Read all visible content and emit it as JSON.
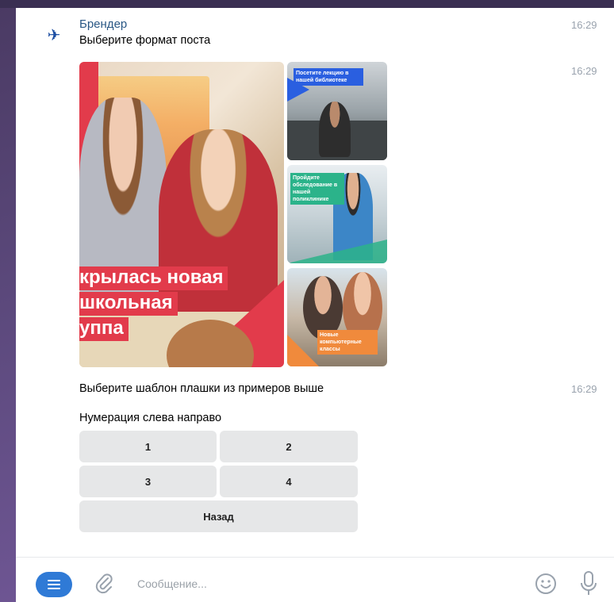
{
  "sender": {
    "name": "Брендер",
    "avatar_icon": "brender-logo-icon"
  },
  "messages": {
    "m1": {
      "text": "Выберите формат поста",
      "time": "16:29"
    },
    "m2": {
      "time": "16:29"
    },
    "m3": {
      "text": "Выберите шаблон плашки из примеров выше",
      "time": "16:29"
    },
    "m4": {
      "text": "Нумерация слева направо"
    }
  },
  "gallery": {
    "big_caption": [
      "крылась новая",
      "школьная",
      "уппа"
    ],
    "tile1_label": "Посетите лекцию в нашей библиотеке",
    "tile2_label": "Пройдите обследование в нашей поликлинике",
    "tile3_label": "Новые компьютерные классы"
  },
  "keyboard": {
    "btn1": "1",
    "btn2": "2",
    "btn3": "3",
    "btn4": "4",
    "back": "Назад"
  },
  "composer": {
    "placeholder": "Сообщение...",
    "menu_icon": "menu-icon",
    "attach_icon": "paperclip-icon",
    "emoji_icon": "smile-icon",
    "mic_icon": "mic-icon"
  },
  "colors": {
    "accent": "#2f7ad6",
    "sender_name": "#2a5885",
    "brand_red": "#e23b4b"
  }
}
